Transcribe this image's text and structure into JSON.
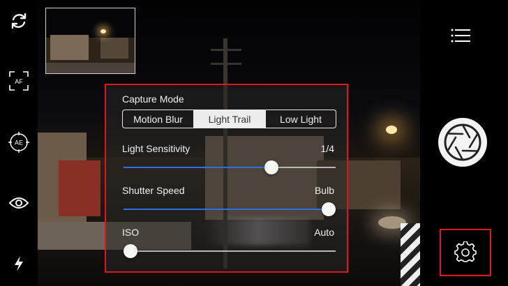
{
  "toolbar_left": {
    "icons": [
      "rotate-camera-icon",
      "autofocus-icon",
      "auto-exposure-icon",
      "eye-icon",
      "flash-icon"
    ],
    "af_label": "AF",
    "ae_label": "AE"
  },
  "capture_mode": {
    "label": "Capture Mode",
    "options": [
      "Motion Blur",
      "Light Trail",
      "Low Light"
    ],
    "selected": "Light Trail"
  },
  "sliders": [
    {
      "label": "Light Sensitivity",
      "value": "1/4",
      "level": 0.71
    },
    {
      "label": "Shutter Speed",
      "value": "Bulb",
      "level": 1.0
    },
    {
      "label": "ISO",
      "value": "Auto",
      "level": 0.0
    }
  ],
  "toolbar_right": {
    "icons": [
      "menu-icon",
      "shutter-icon",
      "settings-gear-icon"
    ]
  },
  "colors": {
    "highlight_border": "#e0161b",
    "slider_fill": "#2d6fe0",
    "segment_selected": "#ececec"
  }
}
